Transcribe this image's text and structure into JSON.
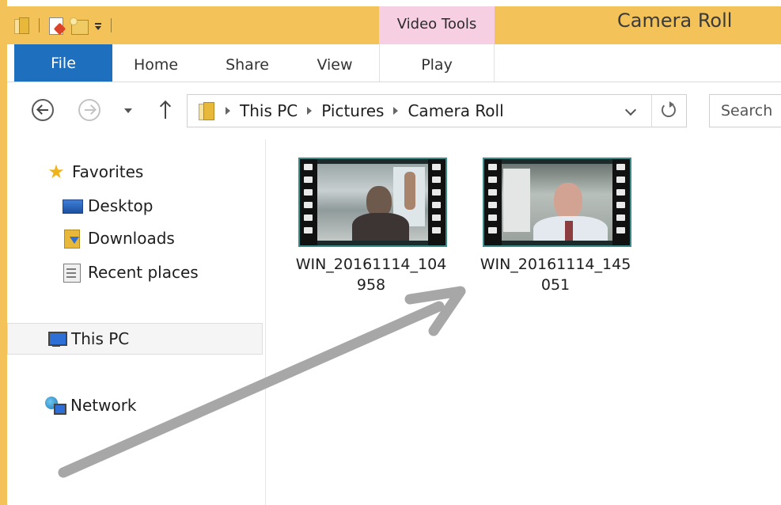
{
  "window": {
    "title": "Camera Roll",
    "context_tab_group": "Video Tools"
  },
  "quick_access": {
    "icons": [
      "folder-icon",
      "properties-icon",
      "new-folder-icon",
      "customize-dropdown-icon"
    ]
  },
  "ribbon": {
    "tabs": [
      {
        "label": "File",
        "active": true
      },
      {
        "label": "Home"
      },
      {
        "label": "Share"
      },
      {
        "label": "View"
      },
      {
        "label": "Play"
      }
    ]
  },
  "address": {
    "crumbs": [
      "This PC",
      "Pictures",
      "Camera Roll"
    ],
    "search_placeholder": "Search"
  },
  "nav_pane": {
    "favorites": "Favorites",
    "desktop": "Desktop",
    "downloads": "Downloads",
    "recent_places": "Recent places",
    "this_pc": "This PC",
    "network": "Network"
  },
  "files": [
    {
      "name": "WIN_20161114_104958",
      "type": "video"
    },
    {
      "name": "WIN_20161114_145051",
      "type": "video"
    }
  ],
  "colors": {
    "title_bar": "#f3c35a",
    "file_tab": "#1f6fbf",
    "video_tools": "#f7cfe3",
    "annotation_arrow": "#a7a7a7"
  }
}
